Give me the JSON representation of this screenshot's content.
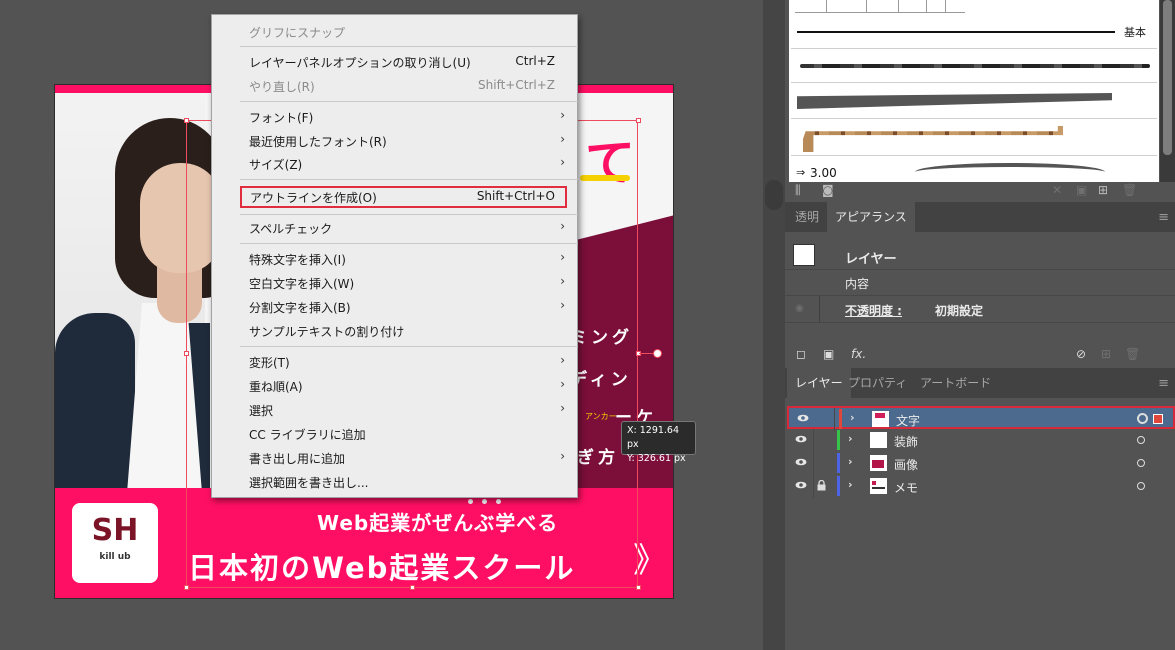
{
  "menu": {
    "items": [
      {
        "label": "グリフにスナップ",
        "shortcut": "",
        "arrow": false,
        "disabled": true
      },
      {
        "label": "レイヤーパネルオプションの取り消し(U)",
        "shortcut": "Ctrl+Z",
        "arrow": false,
        "disabled": false
      },
      {
        "label": "やり直し(R)",
        "shortcut": "Shift+Ctrl+Z",
        "arrow": false,
        "disabled": true
      },
      {
        "label": "フォント(F)",
        "shortcut": "",
        "arrow": true,
        "disabled": false
      },
      {
        "label": "最近使用したフォント(R)",
        "shortcut": "",
        "arrow": true,
        "disabled": false
      },
      {
        "label": "サイズ(Z)",
        "shortcut": "",
        "arrow": true,
        "disabled": false
      },
      {
        "label": "アウトラインを作成(O)",
        "shortcut": "Shift+Ctrl+O",
        "arrow": false,
        "disabled": false
      },
      {
        "label": "スペルチェック",
        "shortcut": "",
        "arrow": true,
        "disabled": false
      },
      {
        "label": "特殊文字を挿入(I)",
        "shortcut": "",
        "arrow": true,
        "disabled": false
      },
      {
        "label": "空白文字を挿入(W)",
        "shortcut": "",
        "arrow": true,
        "disabled": false
      },
      {
        "label": "分割文字を挿入(B)",
        "shortcut": "",
        "arrow": true,
        "disabled": false
      },
      {
        "label": "サンプルテキストの割り付け",
        "shortcut": "",
        "arrow": false,
        "disabled": false
      },
      {
        "label": "変形(T)",
        "shortcut": "",
        "arrow": true,
        "disabled": false
      },
      {
        "label": "重ね順(A)",
        "shortcut": "",
        "arrow": true,
        "disabled": false
      },
      {
        "label": "選択",
        "shortcut": "",
        "arrow": true,
        "disabled": false
      },
      {
        "label": "CC ライブラリに追加",
        "shortcut": "",
        "arrow": false,
        "disabled": false
      },
      {
        "label": "書き出し用に追加",
        "shortcut": "",
        "arrow": true,
        "disabled": false
      },
      {
        "label": "選択範囲を書き出し...",
        "shortcut": "",
        "arrow": false,
        "disabled": false
      }
    ],
    "arrow_glyph": "›"
  },
  "coords": {
    "x": "X: 1291.64 px",
    "y": "Y: 326.61 px"
  },
  "artwork": {
    "title_char": "て",
    "vtext": [
      "ミング",
      "ディン",
      "ーケ",
      "ぎ方"
    ],
    "anchor_tag": "アンカー",
    "logo_main": "SH",
    "logo_sub": "kill ub",
    "line1": "Web起業がぜんぶ学べる",
    "line2": "日本初のWeb起業スクール",
    "chevron": "》"
  },
  "brushes": {
    "basic_label": "基本",
    "size_label": "3.00"
  },
  "appearance": {
    "tabs": [
      "透明",
      "アピアランス"
    ],
    "active_tab": 1,
    "target": "レイヤー",
    "content": "内容",
    "opacity_label": "不透明度 :",
    "opacity_value": "初期設定"
  },
  "layers": {
    "tabs": [
      "レイヤー",
      "プロパティ",
      "アートボード"
    ],
    "active_tab": 0,
    "rows": [
      {
        "name": "文字",
        "color": "#e0473b",
        "locked": false,
        "selected": true
      },
      {
        "name": "装飾",
        "color": "#37c24a",
        "locked": false,
        "selected": false
      },
      {
        "name": "画像",
        "color": "#4d64e6",
        "locked": false,
        "selected": false
      },
      {
        "name": "メモ",
        "color": "#4d64e6",
        "locked": true,
        "selected": false
      }
    ]
  },
  "icons": {
    "chevron": "›",
    "lock": "🔒",
    "menu": "≡"
  }
}
